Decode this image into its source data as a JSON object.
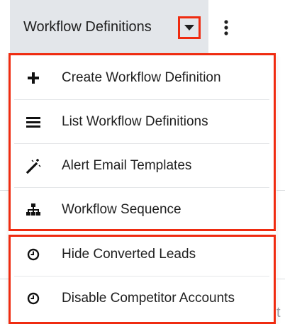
{
  "header": {
    "module_label": "Workflow Definitions",
    "caret_icon": "caret-down-icon",
    "more_icon": "vertical-ellipsis-icon"
  },
  "menu": {
    "group_primary": [
      {
        "label": "Create Workflow Definition",
        "icon": "plus-icon"
      },
      {
        "label": "List Workflow Definitions",
        "icon": "list-icon"
      },
      {
        "label": "Alert Email Templates",
        "icon": "magic-wand-icon"
      },
      {
        "label": "Workflow Sequence",
        "icon": "sitemap-icon"
      }
    ],
    "group_recent": [
      {
        "label": "Hide Converted Leads",
        "icon": "clock-icon"
      },
      {
        "label": "Disable Competitor Accounts",
        "icon": "clock-icon"
      }
    ]
  },
  "background": {
    "cut_text": "t"
  },
  "colors": {
    "highlight": "#ef2b10",
    "tab_bg": "#e3e6ea",
    "text": "#1f1f1f"
  }
}
